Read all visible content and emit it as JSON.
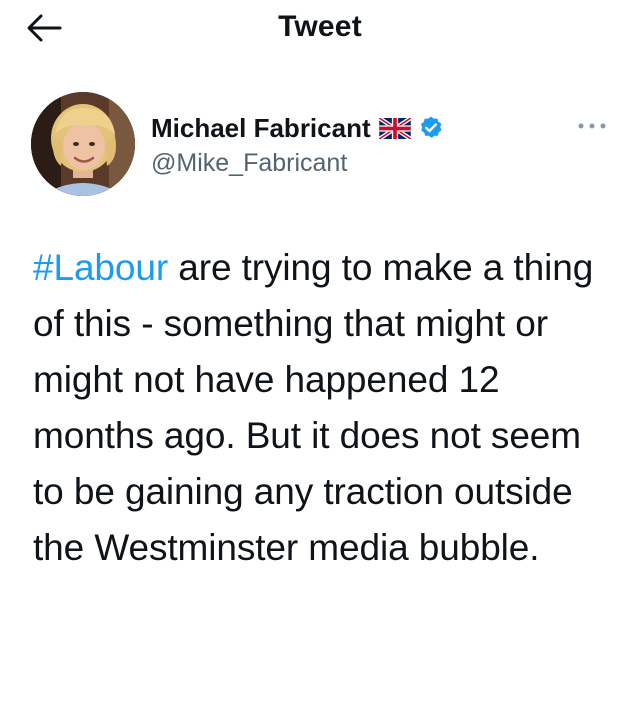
{
  "header": {
    "title": "Tweet",
    "back_icon": "arrow-left-icon"
  },
  "author": {
    "display_name": "Michael Fabricant",
    "handle": "@Mike_Fabricant",
    "flag_icon": "union-jack-flag-icon",
    "verified_icon": "verified-badge-icon",
    "verified_color": "#1d9bf0"
  },
  "more_icon": "more-options-icon",
  "tweet": {
    "hashtag": "#Labour",
    "body": " are trying to make a thing of this - something that might or might not have happened 12 months ago. But it does not seem to be gaining any traction outside the Westminster media bubble."
  },
  "colors": {
    "text": "#0f1419",
    "secondary": "#536471",
    "accent": "#1d9bf0"
  }
}
